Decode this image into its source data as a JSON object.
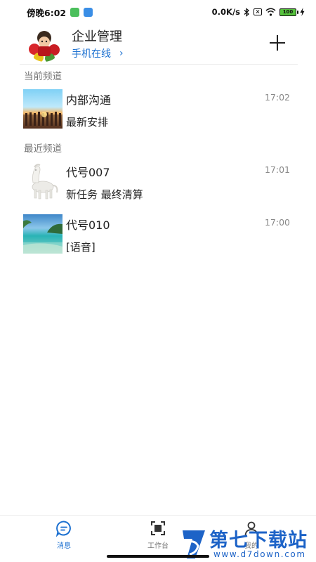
{
  "status_bar": {
    "time": "傍晚6:02",
    "network_speed": "0.0K/s",
    "battery": "100"
  },
  "header": {
    "title": "企业管理",
    "online_status": "手机在线",
    "chevron": "›",
    "add_icon": "plus-icon"
  },
  "sections": {
    "current": "当前频道",
    "recent": "最近频道"
  },
  "chats": [
    {
      "name": "内部沟通",
      "preview": "最新安排",
      "time": "17:02"
    },
    {
      "name": "代号007",
      "preview": "新任务 最终清算",
      "time": "17:01"
    },
    {
      "name": "代号010",
      "preview": "[语音]",
      "time": "17:00"
    }
  ],
  "bottom_nav": [
    {
      "label": "消息",
      "icon": "message-icon",
      "active": true
    },
    {
      "label": "工作台",
      "icon": "workbench-icon",
      "active": false
    },
    {
      "label": "我的",
      "icon": "person-icon",
      "active": false
    }
  ],
  "watermark": {
    "name": "第七下载站",
    "url": "www.d7down.com"
  },
  "colors": {
    "accent": "#1a6fd0",
    "watermark": "#1d63c7"
  }
}
